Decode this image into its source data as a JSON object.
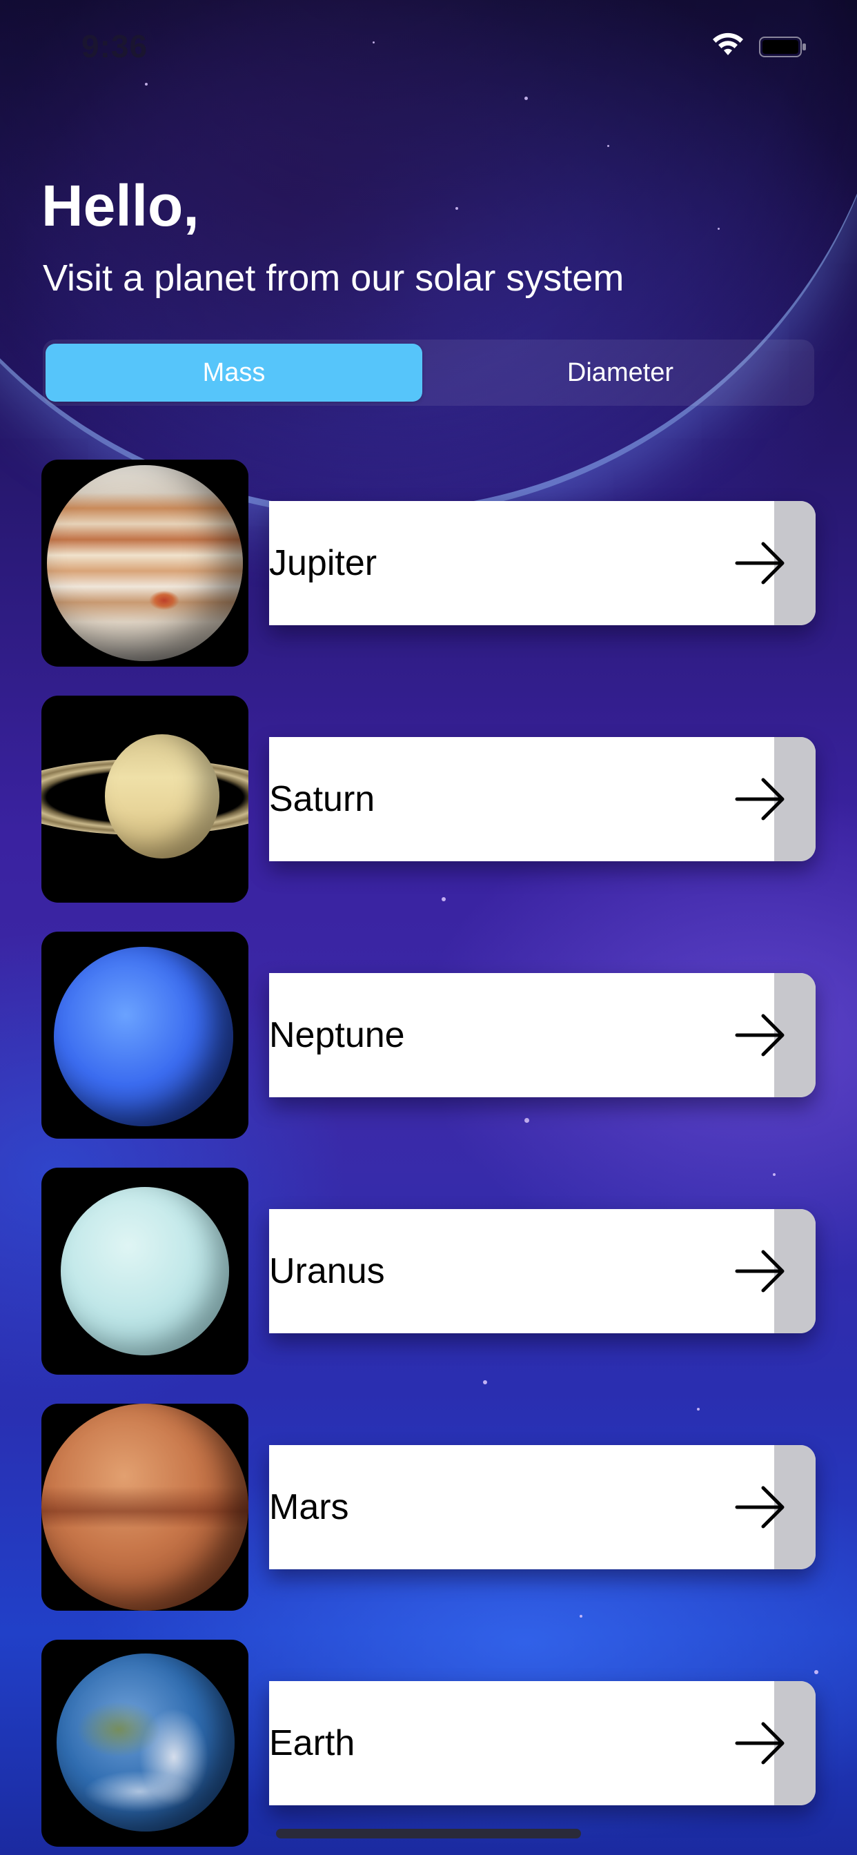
{
  "status_bar": {
    "time": "9:36",
    "icons": [
      "wifi-icon",
      "battery-icon"
    ]
  },
  "header": {
    "greeting": "Hello,",
    "subtitle": "Visit a planet from our solar system"
  },
  "segmented_control": {
    "options": [
      "Mass",
      "Diameter"
    ],
    "selected": "Mass",
    "selected_color": "#56c5fa"
  },
  "planets": [
    {
      "name": "Jupiter",
      "thumbnail": "jupiter-image"
    },
    {
      "name": "Saturn",
      "thumbnail": "saturn-image"
    },
    {
      "name": "Neptune",
      "thumbnail": "neptune-image"
    },
    {
      "name": "Uranus",
      "thumbnail": "uranus-image"
    },
    {
      "name": "Mars",
      "thumbnail": "mars-image"
    },
    {
      "name": "Earth",
      "thumbnail": "earth-image"
    }
  ],
  "icons": {
    "row_arrow": "arrow-right-icon"
  },
  "colors": {
    "card_background": "#ffffff",
    "arrow_strip": "#c7c7cc",
    "background_deep": "#1a0f4a",
    "background_accent": "#2140c8"
  }
}
